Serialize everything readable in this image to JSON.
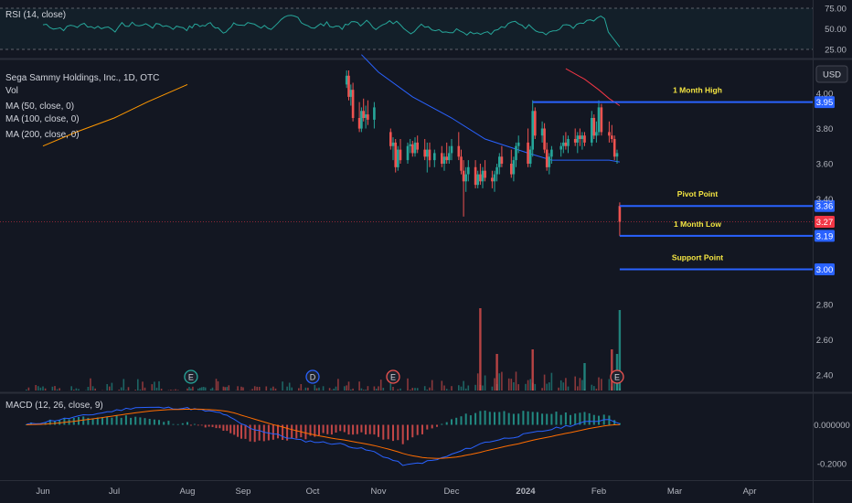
{
  "legend": {
    "rsi": "RSI (14, close)",
    "symbol": "Sega Sammy Holdings, Inc., 1D, OTC",
    "vol": "Vol",
    "ma50": "MA (50, close, 0)",
    "ma100": "MA (100, close, 0)",
    "ma200": "MA (200, close, 0)",
    "macd": "MACD (12, 26, close, 9)"
  },
  "currency": "USD",
  "colors": {
    "background": "#131722",
    "up": "#26a69a",
    "down": "#ef5350",
    "level_line": "#2962ff",
    "level_text": "#f5e642",
    "ma_blue": "#2962ff",
    "ma_red": "#f23645",
    "ma_orange": "#ff9800",
    "rsi_line": "#26a69a",
    "price_marker": "#f23645"
  },
  "chart_data": [
    {
      "type": "line",
      "name": "price",
      "title": "Sega Sammy Holdings, Inc., 1D, OTC",
      "ylim": [
        2.3,
        4.15
      ],
      "yticks": [
        "4.00",
        "3.80",
        "3.60",
        "3.40",
        "2.80",
        "2.60",
        "2.40"
      ],
      "yticks_values": [
        4.0,
        3.8,
        3.6,
        3.4,
        2.8,
        2.6,
        2.4
      ],
      "x_labels": [
        "Jun",
        "Jul",
        "Aug",
        "Sep",
        "Oct",
        "Nov",
        "Dec",
        "2024",
        "Feb",
        "Mar",
        "Apr"
      ],
      "last_price": "3.27",
      "last_price_value": 3.27,
      "levels": [
        {
          "label": "1 Month High",
          "value": 3.95,
          "text": "3.95"
        },
        {
          "label": "Pivot Point",
          "value": 3.36,
          "text": "3.36"
        },
        {
          "label": "1 Month Low",
          "value": 3.19,
          "text": "3.19"
        },
        {
          "label": "Support Point",
          "value": 3.0,
          "text": "3.00"
        }
      ],
      "candles_x": [
        "2023-10-17",
        "2023-10-18",
        "2023-10-19",
        "2023-10-20",
        "2023-10-23",
        "2023-10-24",
        "2023-10-25",
        "2023-10-26",
        "2023-10-27",
        "2023-10-30",
        "2023-11-06",
        "2023-11-07",
        "2023-11-08",
        "2023-11-09",
        "2023-11-10",
        "2023-11-13",
        "2023-11-14",
        "2023-11-15",
        "2023-11-16",
        "2023-11-17",
        "2023-11-20",
        "2023-11-21",
        "2023-11-22",
        "2023-11-24",
        "2023-11-27",
        "2023-11-28",
        "2023-11-29",
        "2023-11-30",
        "2023-12-01",
        "2023-12-04",
        "2023-12-05",
        "2023-12-06",
        "2023-12-07",
        "2023-12-08",
        "2023-12-11",
        "2023-12-12",
        "2023-12-13",
        "2023-12-14",
        "2023-12-15",
        "2023-12-18",
        "2023-12-19",
        "2023-12-20",
        "2023-12-21",
        "2023-12-22",
        "2023-12-26",
        "2023-12-27",
        "2023-12-28",
        "2023-12-29",
        "2024-01-02",
        "2024-01-03",
        "2024-01-04",
        "2024-01-05",
        "2024-01-08",
        "2024-01-09",
        "2024-01-10",
        "2024-01-11",
        "2024-01-12",
        "2024-01-16",
        "2024-01-17",
        "2024-01-18",
        "2024-01-19",
        "2024-01-22",
        "2024-01-23",
        "2024-01-24",
        "2024-01-25",
        "2024-01-26",
        "2024-01-29",
        "2024-01-30",
        "2024-01-31",
        "2024-02-01",
        "2024-02-02",
        "2024-02-05",
        "2024-02-06",
        "2024-02-07",
        "2024-02-08",
        "2024-02-09"
      ],
      "candles": [
        [
          4.05,
          4.13,
          4.03,
          4.1
        ],
        [
          4.1,
          4.13,
          3.96,
          3.98
        ],
        [
          3.98,
          4.05,
          3.93,
          4.02
        ],
        [
          4.02,
          4.06,
          3.84,
          3.86
        ],
        [
          3.86,
          3.95,
          3.78,
          3.8
        ],
        [
          3.8,
          3.92,
          3.78,
          3.9
        ],
        [
          3.9,
          3.97,
          3.84,
          3.86
        ],
        [
          3.86,
          3.93,
          3.8,
          3.88
        ],
        [
          3.88,
          3.96,
          3.82,
          3.85
        ],
        [
          3.85,
          3.95,
          3.8,
          3.92
        ],
        [
          3.78,
          3.8,
          3.68,
          3.7
        ],
        [
          3.7,
          3.75,
          3.62,
          3.72
        ],
        [
          3.72,
          3.74,
          3.55,
          3.58
        ],
        [
          3.58,
          3.7,
          3.56,
          3.68
        ],
        [
          3.68,
          3.74,
          3.6,
          3.62
        ],
        [
          3.62,
          3.72,
          3.6,
          3.7
        ],
        [
          3.7,
          3.74,
          3.66,
          3.71
        ],
        [
          3.71,
          3.73,
          3.64,
          3.66
        ],
        [
          3.66,
          3.75,
          3.64,
          3.72
        ],
        [
          3.72,
          3.76,
          3.66,
          3.68
        ],
        [
          3.68,
          3.74,
          3.62,
          3.64
        ],
        [
          3.64,
          3.72,
          3.55,
          3.68
        ],
        [
          3.68,
          3.72,
          3.58,
          3.62
        ],
        [
          3.62,
          3.68,
          3.58,
          3.66
        ],
        [
          3.66,
          3.7,
          3.58,
          3.6
        ],
        [
          3.6,
          3.66,
          3.56,
          3.64
        ],
        [
          3.64,
          3.72,
          3.6,
          3.62
        ],
        [
          3.62,
          3.7,
          3.6,
          3.66
        ],
        [
          3.66,
          3.74,
          3.62,
          3.7
        ],
        [
          3.7,
          3.78,
          3.62,
          3.64
        ],
        [
          3.64,
          3.68,
          3.54,
          3.56
        ],
        [
          3.56,
          3.62,
          3.3,
          3.5
        ],
        [
          3.5,
          3.58,
          3.44,
          3.54
        ],
        [
          3.54,
          3.62,
          3.5,
          3.58
        ],
        [
          3.58,
          3.62,
          3.46,
          3.48
        ],
        [
          3.48,
          3.56,
          3.46,
          3.54
        ],
        [
          3.54,
          3.6,
          3.48,
          3.5
        ],
        [
          3.5,
          3.58,
          3.46,
          3.56
        ],
        [
          3.56,
          3.62,
          3.5,
          3.52
        ],
        [
          3.52,
          3.56,
          3.46,
          3.5
        ],
        [
          3.5,
          3.56,
          3.44,
          3.54
        ],
        [
          3.54,
          3.6,
          3.5,
          3.58
        ],
        [
          3.58,
          3.66,
          3.54,
          3.64
        ],
        [
          3.64,
          3.7,
          3.58,
          3.6
        ],
        [
          3.6,
          3.68,
          3.52,
          3.54
        ],
        [
          3.54,
          3.64,
          3.5,
          3.62
        ],
        [
          3.62,
          3.72,
          3.58,
          3.7
        ],
        [
          3.7,
          3.76,
          3.66,
          3.72
        ],
        [
          3.72,
          3.8,
          3.58,
          3.6
        ],
        [
          3.6,
          3.7,
          3.58,
          3.68
        ],
        [
          3.68,
          3.96,
          3.64,
          3.9
        ],
        [
          3.9,
          3.92,
          3.74,
          3.76
        ],
        [
          3.76,
          3.84,
          3.72,
          3.8
        ],
        [
          3.8,
          3.83,
          3.66,
          3.68
        ],
        [
          3.68,
          3.72,
          3.56,
          3.58
        ],
        [
          3.58,
          3.66,
          3.54,
          3.64
        ],
        [
          3.64,
          3.7,
          3.6,
          3.68
        ],
        [
          3.68,
          3.72,
          3.64,
          3.7
        ],
        [
          3.7,
          3.76,
          3.66,
          3.72
        ],
        [
          3.72,
          3.78,
          3.68,
          3.7
        ],
        [
          3.7,
          3.76,
          3.66,
          3.74
        ],
        [
          3.74,
          3.8,
          3.7,
          3.72
        ],
        [
          3.72,
          3.78,
          3.66,
          3.76
        ],
        [
          3.76,
          3.8,
          3.7,
          3.74
        ],
        [
          3.74,
          3.78,
          3.68,
          3.76
        ],
        [
          3.76,
          3.78,
          3.7,
          3.72
        ],
        [
          3.72,
          3.9,
          3.7,
          3.86
        ],
        [
          3.86,
          3.88,
          3.74,
          3.76
        ],
        [
          3.76,
          3.84,
          3.72,
          3.78
        ],
        [
          3.78,
          3.96,
          3.76,
          3.92
        ],
        [
          3.92,
          3.94,
          3.76,
          3.78
        ],
        [
          3.78,
          3.84,
          3.72,
          3.76
        ],
        [
          3.76,
          3.82,
          3.72,
          3.74
        ],
        [
          3.74,
          3.76,
          3.62,
          3.64
        ],
        [
          3.64,
          3.68,
          3.6,
          3.66
        ],
        [
          3.36,
          3.38,
          3.19,
          3.27
        ]
      ],
      "ma50_dates": [
        "2023-10-24",
        "2023-11-01",
        "2023-11-15",
        "2023-12-01",
        "2023-12-15",
        "2024-01-02",
        "2024-01-12",
        "2024-01-22",
        "2024-01-31",
        "2024-02-05",
        "2024-02-09"
      ],
      "ma50": [
        4.22,
        4.12,
        3.98,
        3.86,
        3.74,
        3.66,
        3.62,
        3.62,
        3.62,
        3.62,
        3.61
      ],
      "ma100_dates": [
        "2024-01-18",
        "2024-01-26",
        "2024-02-01",
        "2024-02-05",
        "2024-02-09"
      ],
      "ma100": [
        4.14,
        4.08,
        4.02,
        3.97,
        3.93
      ],
      "ma200_dates": [
        "2023-06-01",
        "2023-06-15",
        "2023-07-01",
        "2023-07-15",
        "2023-08-01"
      ],
      "ma200": [
        3.7,
        3.78,
        3.86,
        3.95,
        4.05
      ]
    },
    {
      "type": "bar",
      "name": "volume",
      "title": "Vol",
      "markers": [
        {
          "date": "2023-08-03",
          "label": "E"
        },
        {
          "date": "2023-10-01",
          "label": "D"
        },
        {
          "date": "2023-11-07",
          "label": "E"
        },
        {
          "date": "2024-02-08",
          "label": "E"
        }
      ]
    },
    {
      "type": "line",
      "name": "rsi",
      "title": "RSI (14, close)",
      "ylim": [
        20,
        80
      ],
      "yticks": [
        "75.00",
        "50.00",
        "25.00"
      ],
      "yticks_values": [
        75,
        50,
        25
      ]
    },
    {
      "type": "bar",
      "name": "macd",
      "title": "MACD (12, 26, close, 9)",
      "ylim": [
        -0.26,
        0.1
      ],
      "yticks": [
        "0.000000",
        "-0.2000"
      ],
      "yticks_values": [
        0.0,
        -0.2
      ]
    }
  ]
}
